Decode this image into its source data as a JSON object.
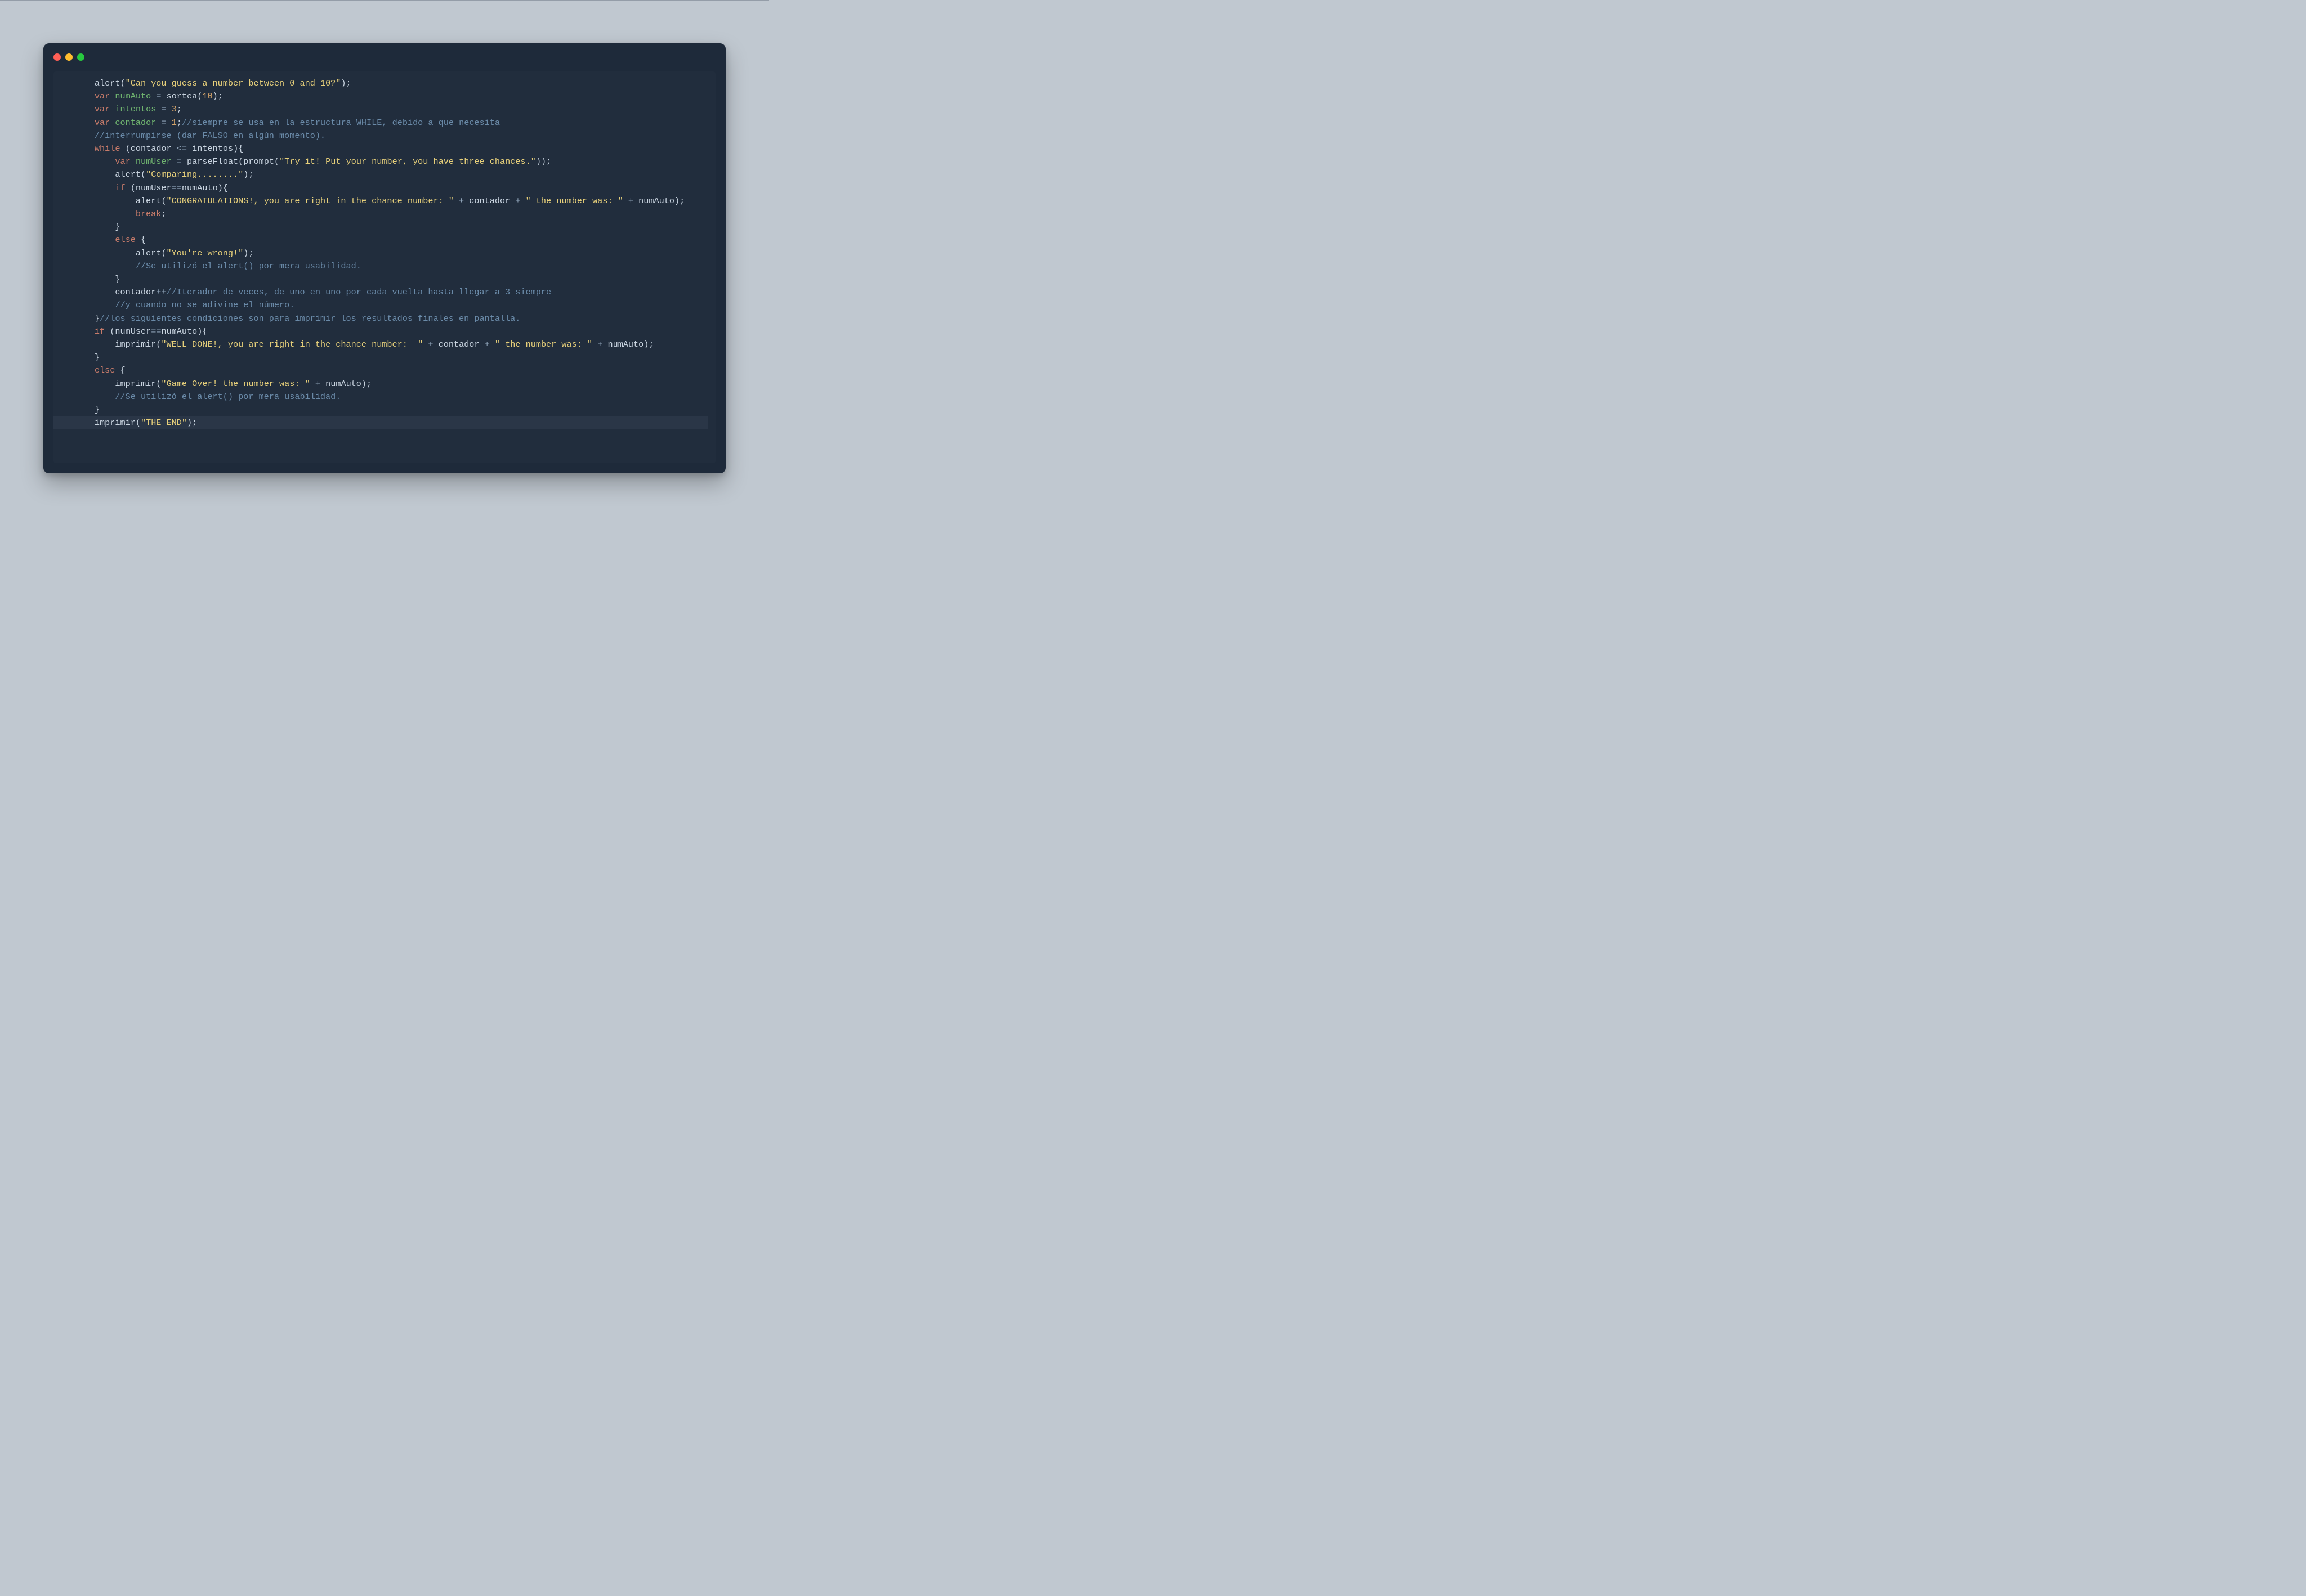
{
  "colors": {
    "bg_page": "#c0c8d0",
    "bg_window": "#1e2a3a",
    "bg_code": "#212d3d",
    "dot_red": "#ff5f56",
    "dot_yellow": "#ffbd2e",
    "dot_green": "#27c93f",
    "text_default": "#c9d4e0",
    "text_keyword": "#c77b6a",
    "text_varname": "#6fb36f",
    "text_number": "#d3a36a",
    "text_string": "#e6cf7a",
    "text_comment": "#6a8aa8",
    "hl_line": "#2a3647"
  },
  "code_lines": [
    [
      [
        "sp",
        "        "
      ],
      [
        "fn",
        "alert"
      ],
      [
        "punc",
        "("
      ],
      [
        "str",
        "\"Can you guess a number between 0 and 10?\""
      ],
      [
        "punc",
        ");"
      ]
    ],
    [
      [
        "sp",
        "        "
      ],
      [
        "kw",
        "var"
      ],
      [
        "sp",
        " "
      ],
      [
        "var",
        "numAuto"
      ],
      [
        "sp",
        " "
      ],
      [
        "op",
        "="
      ],
      [
        "sp",
        " "
      ],
      [
        "fn",
        "sortea"
      ],
      [
        "punc",
        "("
      ],
      [
        "num",
        "10"
      ],
      [
        "punc",
        ");"
      ]
    ],
    [
      [
        "sp",
        "        "
      ],
      [
        "kw",
        "var"
      ],
      [
        "sp",
        " "
      ],
      [
        "var",
        "intentos"
      ],
      [
        "sp",
        " "
      ],
      [
        "op",
        "="
      ],
      [
        "sp",
        " "
      ],
      [
        "num",
        "3"
      ],
      [
        "punc",
        ";"
      ]
    ],
    [
      [
        "sp",
        "        "
      ],
      [
        "kw",
        "var"
      ],
      [
        "sp",
        " "
      ],
      [
        "var",
        "contador"
      ],
      [
        "sp",
        " "
      ],
      [
        "op",
        "="
      ],
      [
        "sp",
        " "
      ],
      [
        "num",
        "1"
      ],
      [
        "punc",
        ";"
      ],
      [
        "com",
        "//siempre se usa en la estructura WHILE, debido a que necesita"
      ]
    ],
    [
      [
        "sp",
        "        "
      ],
      [
        "com",
        "//interrumpirse (dar FALSO en algún momento)."
      ]
    ],
    [
      [
        "sp",
        "        "
      ],
      [
        "kw",
        "while"
      ],
      [
        "sp",
        " "
      ],
      [
        "punc",
        "("
      ],
      [
        "fn",
        "contador"
      ],
      [
        "sp",
        " "
      ],
      [
        "op",
        "<="
      ],
      [
        "sp",
        " "
      ],
      [
        "fn",
        "intentos"
      ],
      [
        "punc",
        "){"
      ]
    ],
    [
      [
        "sp",
        "            "
      ],
      [
        "kw",
        "var"
      ],
      [
        "sp",
        " "
      ],
      [
        "var",
        "numUser"
      ],
      [
        "sp",
        " "
      ],
      [
        "op",
        "="
      ],
      [
        "sp",
        " "
      ],
      [
        "fn",
        "parseFloat"
      ],
      [
        "punc",
        "("
      ],
      [
        "fn",
        "prompt"
      ],
      [
        "punc",
        "("
      ],
      [
        "str",
        "\"Try it! Put your number, you have three chances.\""
      ],
      [
        "punc",
        "));"
      ]
    ],
    [
      [
        "sp",
        "            "
      ],
      [
        "fn",
        "alert"
      ],
      [
        "punc",
        "("
      ],
      [
        "str",
        "\"Comparing........\""
      ],
      [
        "punc",
        ");"
      ]
    ],
    [
      [
        "sp",
        "            "
      ],
      [
        "kw",
        "if"
      ],
      [
        "sp",
        " "
      ],
      [
        "punc",
        "("
      ],
      [
        "fn",
        "numUser"
      ],
      [
        "op",
        "=="
      ],
      [
        "fn",
        "numAuto"
      ],
      [
        "punc",
        "){"
      ]
    ],
    [
      [
        "sp",
        "                "
      ],
      [
        "fn",
        "alert"
      ],
      [
        "punc",
        "("
      ],
      [
        "str",
        "\"CONGRATULATIONS!, you are right in the chance number: \""
      ],
      [
        "sp",
        " "
      ],
      [
        "op",
        "+"
      ],
      [
        "sp",
        " "
      ],
      [
        "fn",
        "contador"
      ],
      [
        "sp",
        " "
      ],
      [
        "op",
        "+"
      ],
      [
        "sp",
        " "
      ],
      [
        "str",
        "\" the number was: \""
      ],
      [
        "sp",
        " "
      ],
      [
        "op",
        "+"
      ],
      [
        "sp",
        " "
      ],
      [
        "fn",
        "numAuto"
      ],
      [
        "punc",
        ");"
      ]
    ],
    [
      [
        "sp",
        "                "
      ],
      [
        "kw",
        "break"
      ],
      [
        "punc",
        ";"
      ]
    ],
    [
      [
        "sp",
        "            "
      ],
      [
        "punc",
        "}"
      ]
    ],
    [
      [
        "sp",
        "            "
      ],
      [
        "kw",
        "else"
      ],
      [
        "sp",
        " "
      ],
      [
        "punc",
        "{"
      ]
    ],
    [
      [
        "sp",
        "                "
      ],
      [
        "fn",
        "alert"
      ],
      [
        "punc",
        "("
      ],
      [
        "str",
        "\"You're wrong!\""
      ],
      [
        "punc",
        ");"
      ]
    ],
    [
      [
        "sp",
        "                "
      ],
      [
        "com",
        "//Se utilizó el alert() por mera usabilidad."
      ]
    ],
    [
      [
        "sp",
        "            "
      ],
      [
        "punc",
        "}"
      ]
    ],
    [
      [
        "sp",
        "            "
      ],
      [
        "fn",
        "contador"
      ],
      [
        "op",
        "++"
      ],
      [
        "com",
        "//Iterador de veces, de uno en uno por cada vuelta hasta llegar a 3 siempre"
      ]
    ],
    [
      [
        "sp",
        "            "
      ],
      [
        "com",
        "//y cuando no se adivine el número."
      ]
    ],
    [
      [
        "sp",
        "        "
      ],
      [
        "punc",
        "}"
      ],
      [
        "com",
        "//los siguientes condiciones son para imprimir los resultados finales en pantalla."
      ]
    ],
    [
      [
        "sp",
        "        "
      ],
      [
        "kw",
        "if"
      ],
      [
        "sp",
        " "
      ],
      [
        "punc",
        "("
      ],
      [
        "fn",
        "numUser"
      ],
      [
        "op",
        "=="
      ],
      [
        "fn",
        "numAuto"
      ],
      [
        "punc",
        "){"
      ]
    ],
    [
      [
        "sp",
        "            "
      ],
      [
        "fn",
        "imprimir"
      ],
      [
        "punc",
        "("
      ],
      [
        "str",
        "\"WELL DONE!, you are right in the chance number:  \""
      ],
      [
        "sp",
        " "
      ],
      [
        "op",
        "+"
      ],
      [
        "sp",
        " "
      ],
      [
        "fn",
        "contador"
      ],
      [
        "sp",
        " "
      ],
      [
        "op",
        "+"
      ],
      [
        "sp",
        " "
      ],
      [
        "str",
        "\" the number was: \""
      ],
      [
        "sp",
        " "
      ],
      [
        "op",
        "+"
      ],
      [
        "sp",
        " "
      ],
      [
        "fn",
        "numAuto"
      ],
      [
        "punc",
        ");"
      ]
    ],
    [
      [
        "sp",
        "        "
      ],
      [
        "punc",
        "}"
      ]
    ],
    [
      [
        "sp",
        "        "
      ],
      [
        "kw",
        "else"
      ],
      [
        "sp",
        " "
      ],
      [
        "punc",
        "{"
      ]
    ],
    [
      [
        "sp",
        "            "
      ],
      [
        "fn",
        "imprimir"
      ],
      [
        "punc",
        "("
      ],
      [
        "str",
        "\"Game Over! the number was: \""
      ],
      [
        "sp",
        " "
      ],
      [
        "op",
        "+"
      ],
      [
        "sp",
        " "
      ],
      [
        "fn",
        "numAuto"
      ],
      [
        "punc",
        ");"
      ]
    ],
    [
      [
        "sp",
        "            "
      ],
      [
        "com",
        "//Se utilizó el alert() por mera usabilidad."
      ]
    ],
    [
      [
        "sp",
        "        "
      ],
      [
        "punc",
        "}"
      ]
    ],
    [
      [
        "sp",
        "        "
      ],
      [
        "fn",
        "imprimir"
      ],
      [
        "punc",
        "("
      ],
      [
        "str",
        "\"THE END\""
      ],
      [
        "punc",
        ");"
      ]
    ]
  ],
  "highlighted_line_index": 26
}
